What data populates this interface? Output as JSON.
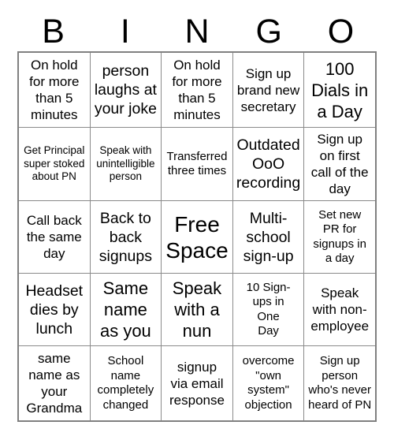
{
  "header": {
    "letters": [
      "B",
      "I",
      "N",
      "G",
      "O"
    ]
  },
  "grid": {
    "rows": [
      [
        {
          "text": "On hold\nfor more\nthan 5\nminutes",
          "size": "md"
        },
        {
          "text": "person\nlaughs at\nyour joke",
          "size": "lg"
        },
        {
          "text": "On hold\nfor more\nthan 5\nminutes",
          "size": "md"
        },
        {
          "text": "Sign up\nbrand new\nsecretary",
          "size": "md"
        },
        {
          "text": "100\nDials in\na Day",
          "size": "xl"
        }
      ],
      [
        {
          "text": "Get Principal\nsuper stoked\nabout PN",
          "size": "xs"
        },
        {
          "text": "Speak with\nunintelligible\nperson",
          "size": "xs"
        },
        {
          "text": "Transferred\nthree times",
          "size": "sm"
        },
        {
          "text": "Outdated\nOoO\nrecording",
          "size": "lg"
        },
        {
          "text": "Sign up\non first\ncall of the\nday",
          "size": "md"
        }
      ],
      [
        {
          "text": "Call back\nthe same\nday",
          "size": "md"
        },
        {
          "text": "Back to\nback\nsignups",
          "size": "lg"
        },
        {
          "text": "Free\nSpace",
          "size": "free"
        },
        {
          "text": "Multi-\nschool\nsign-up",
          "size": "lg"
        },
        {
          "text": "Set new\nPR for\nsignups in\na day",
          "size": "sm"
        }
      ],
      [
        {
          "text": "Headset\ndies by\nlunch",
          "size": "lg"
        },
        {
          "text": "Same\nname\nas you",
          "size": "xl"
        },
        {
          "text": "Speak\nwith a\nnun",
          "size": "xl"
        },
        {
          "text": "10 Sign-\nups in\nOne\nDay",
          "size": "sm"
        },
        {
          "text": "Speak\nwith non-\nemployee",
          "size": "md"
        }
      ],
      [
        {
          "text": "same\nname as\nyour\nGrandma",
          "size": "md"
        },
        {
          "text": "School\nname\ncompletely\nchanged",
          "size": "sm"
        },
        {
          "text": "signup\nvia email\nresponse",
          "size": "md"
        },
        {
          "text": "overcome\n\"own\nsystem\"\nobjection",
          "size": "sm"
        },
        {
          "text": "Sign up\nperson\nwho's never\nheard of PN",
          "size": "sm"
        }
      ]
    ]
  },
  "colors": {
    "background": "#ffffff",
    "text": "#000000",
    "grid_line": "#8a8a8a",
    "grid_border": "#808080"
  }
}
